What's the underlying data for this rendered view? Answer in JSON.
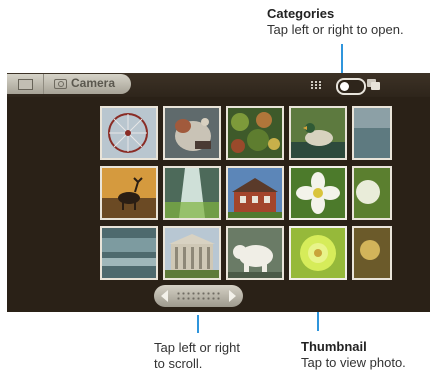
{
  "callouts": {
    "categories": {
      "title": "Categories",
      "body": "Tap left or right to open."
    },
    "scroll": {
      "line1": "Tap left or right",
      "line2": "to scroll."
    },
    "thumbnail": {
      "title": "Thumbnail",
      "body": "Tap to view photo."
    }
  },
  "breadcrumb": {
    "camera_label": "Camera"
  },
  "icons": [
    "gallery-home-icon",
    "camera-icon",
    "grid-view-icon",
    "view-toggle-switch",
    "stack-view-icon",
    "scroll-left-arrow-icon",
    "scroll-right-arrow-icon"
  ],
  "colors": {
    "callout_line": "#2f95dc",
    "screen_bg": "#2a2117"
  },
  "thumbnails": [
    "ferris-wheel-photo",
    "stuffed-animal-photo",
    "coral-reef-photo",
    "duck-photo",
    "edge-photo-1",
    "deer-sunset-photo",
    "waterfall-photo",
    "brick-house-photo",
    "white-flower-photo",
    "edge-photo-2",
    "water-photo",
    "columned-building-photo",
    "polar-bear-photo",
    "green-flower-photo",
    "edge-photo-3"
  ]
}
